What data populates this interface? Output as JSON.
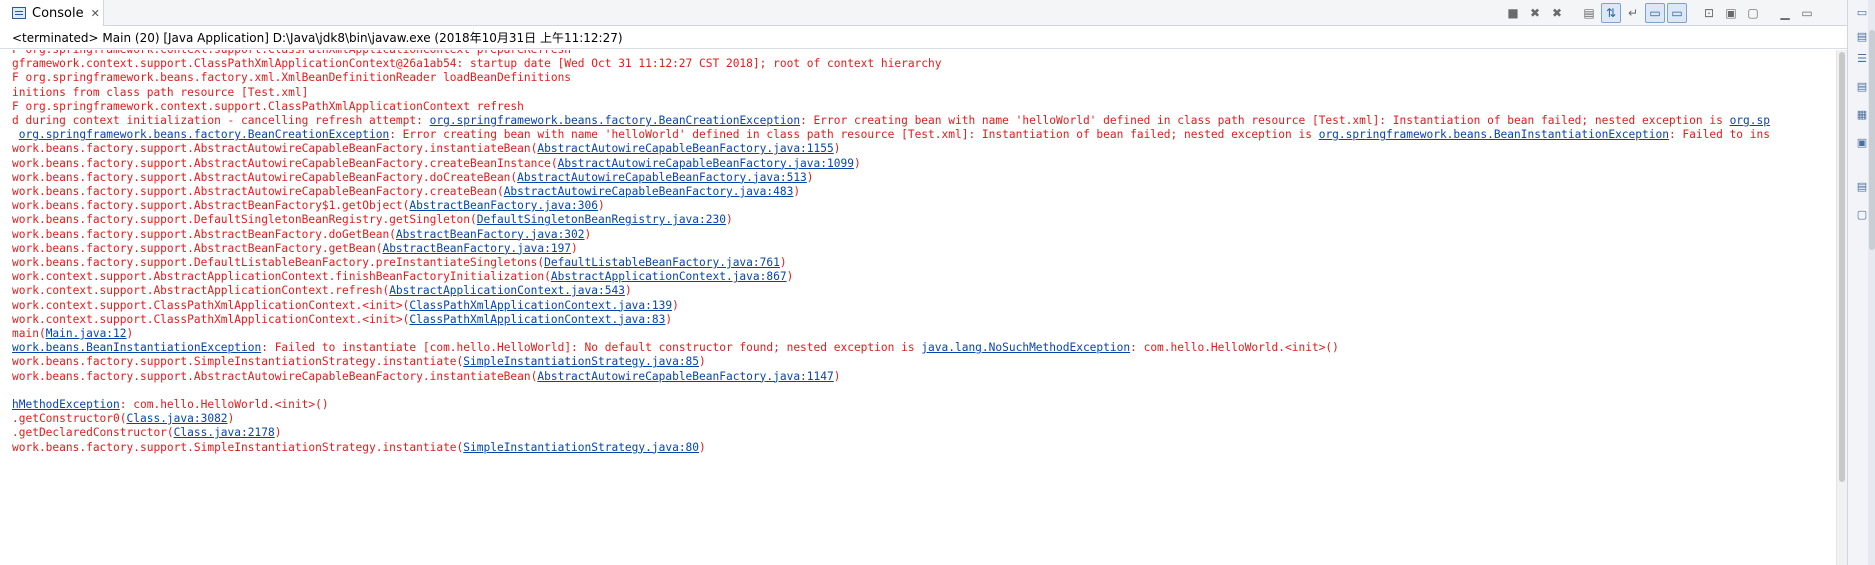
{
  "tab": {
    "title": "Console",
    "close": "✕"
  },
  "status": "<terminated> Main (20) [Java Application] D:\\Java\\jdk8\\bin\\javaw.exe (2018年10月31日 上午11:12:27)",
  "toolbar": [
    {
      "name": "terminate-icon",
      "glyph": "■"
    },
    {
      "name": "remove-launch-icon",
      "glyph": "✖"
    },
    {
      "name": "remove-all-icon",
      "glyph": "✖"
    },
    {
      "name": "clear-console-icon",
      "glyph": "▤"
    },
    {
      "name": "scroll-lock-icon",
      "glyph": "⇅"
    },
    {
      "name": "word-wrap-icon",
      "glyph": "↵"
    },
    {
      "name": "show-stdout-icon",
      "glyph": "▭"
    },
    {
      "name": "show-stderr-icon",
      "glyph": "▭"
    },
    {
      "name": "pin-console-icon",
      "glyph": "⊡"
    },
    {
      "name": "display-console-icon",
      "glyph": "▣"
    },
    {
      "name": "open-console-icon",
      "glyph": "▢"
    },
    {
      "name": "minimize-icon",
      "glyph": "▁"
    },
    {
      "name": "maximize-icon",
      "glyph": "▭"
    }
  ],
  "console_lines": [
    [
      {
        "t": "F org.springframework.context.support.ClassPathXmlApplicationContext prepareRefresh"
      }
    ],
    [
      {
        "t": "gframework.context.support.ClassPathXmlApplicationContext@26a1ab54: startup date [Wed Oct 31 11:12:27 CST 2018]; root of context hierarchy"
      }
    ],
    [
      {
        "t": "F org.springframework.beans.factory.xml.XmlBeanDefinitionReader loadBeanDefinitions"
      }
    ],
    [
      {
        "t": "initions from class path resource [Test.xml]"
      }
    ],
    [
      {
        "t": "F org.springframework.context.support.ClassPathXmlApplicationContext refresh"
      }
    ],
    [
      {
        "t": "d during context initialization - cancelling refresh attempt: "
      },
      {
        "t": "org.springframework.beans.factory.BeanCreationException",
        "link": true
      },
      {
        "t": ": Error creating bean with name 'helloWorld' defined in class path resource [Test.xml]: Instantiation of bean failed; nested exception is "
      },
      {
        "t": "org.sp",
        "link": true
      }
    ],
    [
      {
        "t": " "
      },
      {
        "t": "org.springframework.beans.factory.BeanCreationException",
        "link": true
      },
      {
        "t": ": Error creating bean with name 'helloWorld' defined in class path resource [Test.xml]: Instantiation of bean failed; nested exception is "
      },
      {
        "t": "org.springframework.beans.BeanInstantiationException",
        "link": true
      },
      {
        "t": ": Failed to ins"
      }
    ],
    [
      {
        "t": "work.beans.factory.support.AbstractAutowireCapableBeanFactory.instantiateBean("
      },
      {
        "t": "AbstractAutowireCapableBeanFactory.java:1155",
        "link": true
      },
      {
        "t": ")"
      }
    ],
    [
      {
        "t": "work.beans.factory.support.AbstractAutowireCapableBeanFactory.createBeanInstance("
      },
      {
        "t": "AbstractAutowireCapableBeanFactory.java:1099",
        "link": true
      },
      {
        "t": ")"
      }
    ],
    [
      {
        "t": "work.beans.factory.support.AbstractAutowireCapableBeanFactory.doCreateBean("
      },
      {
        "t": "AbstractAutowireCapableBeanFactory.java:513",
        "link": true
      },
      {
        "t": ")"
      }
    ],
    [
      {
        "t": "work.beans.factory.support.AbstractAutowireCapableBeanFactory.createBean("
      },
      {
        "t": "AbstractAutowireCapableBeanFactory.java:483",
        "link": true
      },
      {
        "t": ")"
      }
    ],
    [
      {
        "t": "work.beans.factory.support.AbstractBeanFactory$1.getObject("
      },
      {
        "t": "AbstractBeanFactory.java:306",
        "link": true
      },
      {
        "t": ")"
      }
    ],
    [
      {
        "t": "work.beans.factory.support.DefaultSingletonBeanRegistry.getSingleton("
      },
      {
        "t": "DefaultSingletonBeanRegistry.java:230",
        "link": true
      },
      {
        "t": ")"
      }
    ],
    [
      {
        "t": "work.beans.factory.support.AbstractBeanFactory.doGetBean("
      },
      {
        "t": "AbstractBeanFactory.java:302",
        "link": true
      },
      {
        "t": ")"
      }
    ],
    [
      {
        "t": "work.beans.factory.support.AbstractBeanFactory.getBean("
      },
      {
        "t": "AbstractBeanFactory.java:197",
        "link": true
      },
      {
        "t": ")"
      }
    ],
    [
      {
        "t": "work.beans.factory.support.DefaultListableBeanFactory.preInstantiateSingletons("
      },
      {
        "t": "DefaultListableBeanFactory.java:761",
        "link": true
      },
      {
        "t": ")"
      }
    ],
    [
      {
        "t": "work.context.support.AbstractApplicationContext.finishBeanFactoryInitialization("
      },
      {
        "t": "AbstractApplicationContext.java:867",
        "link": true
      },
      {
        "t": ")"
      }
    ],
    [
      {
        "t": "work.context.support.AbstractApplicationContext.refresh("
      },
      {
        "t": "AbstractApplicationContext.java:543",
        "link": true
      },
      {
        "t": ")"
      }
    ],
    [
      {
        "t": "work.context.support.ClassPathXmlApplicationContext.<init>("
      },
      {
        "t": "ClassPathXmlApplicationContext.java:139",
        "link": true
      },
      {
        "t": ")"
      }
    ],
    [
      {
        "t": "work.context.support.ClassPathXmlApplicationContext.<init>("
      },
      {
        "t": "ClassPathXmlApplicationContext.java:83",
        "link": true
      },
      {
        "t": ")"
      }
    ],
    [
      {
        "t": "main("
      },
      {
        "t": "Main.java:12",
        "link": true
      },
      {
        "t": ")"
      }
    ],
    [
      {
        "t": "work.beans.BeanInstantiationException",
        "link": true
      },
      {
        "t": ": Failed to instantiate [com.hello.HelloWorld]: No default constructor found; nested exception is "
      },
      {
        "t": "java.lang.NoSuchMethodException",
        "link": true
      },
      {
        "t": ": com.hello.HelloWorld.<init>()"
      }
    ],
    [
      {
        "t": "work.beans.factory.support.SimpleInstantiationStrategy.instantiate("
      },
      {
        "t": "SimpleInstantiationStrategy.java:85",
        "link": true
      },
      {
        "t": ")"
      }
    ],
    [
      {
        "t": "work.beans.factory.support.AbstractAutowireCapableBeanFactory.instantiateBean("
      },
      {
        "t": "AbstractAutowireCapableBeanFactory.java:1147",
        "link": true
      },
      {
        "t": ")"
      }
    ],
    [],
    [
      {
        "t": "hMethodException",
        "link": true
      },
      {
        "t": ": com.hello.HelloWorld.<init>()"
      }
    ],
    [
      {
        "t": ".getConstructor0("
      },
      {
        "t": "Class.java:3082",
        "link": true
      },
      {
        "t": ")"
      }
    ],
    [
      {
        "t": ".getDeclaredConstructor("
      },
      {
        "t": "Class.java:2178",
        "link": true
      },
      {
        "t": ")"
      }
    ],
    [
      {
        "t": "work.beans.factory.support.SimpleInstantiationStrategy.instantiate("
      },
      {
        "t": "SimpleInstantiationStrategy.java:80",
        "link": true
      },
      {
        "t": ")"
      }
    ]
  ],
  "colors": {
    "error_text": "#e41b1b",
    "link": "#0645ad"
  }
}
